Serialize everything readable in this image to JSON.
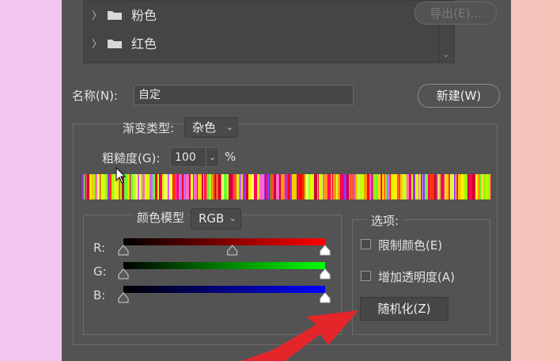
{
  "presets": {
    "items": [
      {
        "label": "粉色"
      },
      {
        "label": "红色"
      }
    ]
  },
  "buttons": {
    "export_label": "导出(E)...",
    "new_label": "新建(W)",
    "randomize_label": "随机化(Z)"
  },
  "name_field": {
    "label": "名称(N):",
    "value": "自定"
  },
  "gradient_type": {
    "label": "渐变类型:",
    "value": "杂色"
  },
  "roughness": {
    "label": "粗糙度(G):",
    "value": "100",
    "unit": "%"
  },
  "color_model": {
    "label": "颜色模型",
    "value": "RGB",
    "channels": [
      {
        "name": "R:",
        "low": 0.0,
        "high": 1.0,
        "mid": 0.54
      },
      {
        "name": "G:",
        "low": 0.0,
        "high": 1.0
      },
      {
        "name": "B:",
        "low": 0.0,
        "high": 1.0
      }
    ]
  },
  "options": {
    "title": "选项:",
    "restrict_colors": {
      "label": "限制颜色(E)",
      "checked": false
    },
    "add_transparency": {
      "label": "增加透明度(A)",
      "checked": false
    }
  },
  "colors": {
    "panel_bg": "#535353",
    "accent_arrow": "#e4262b"
  }
}
